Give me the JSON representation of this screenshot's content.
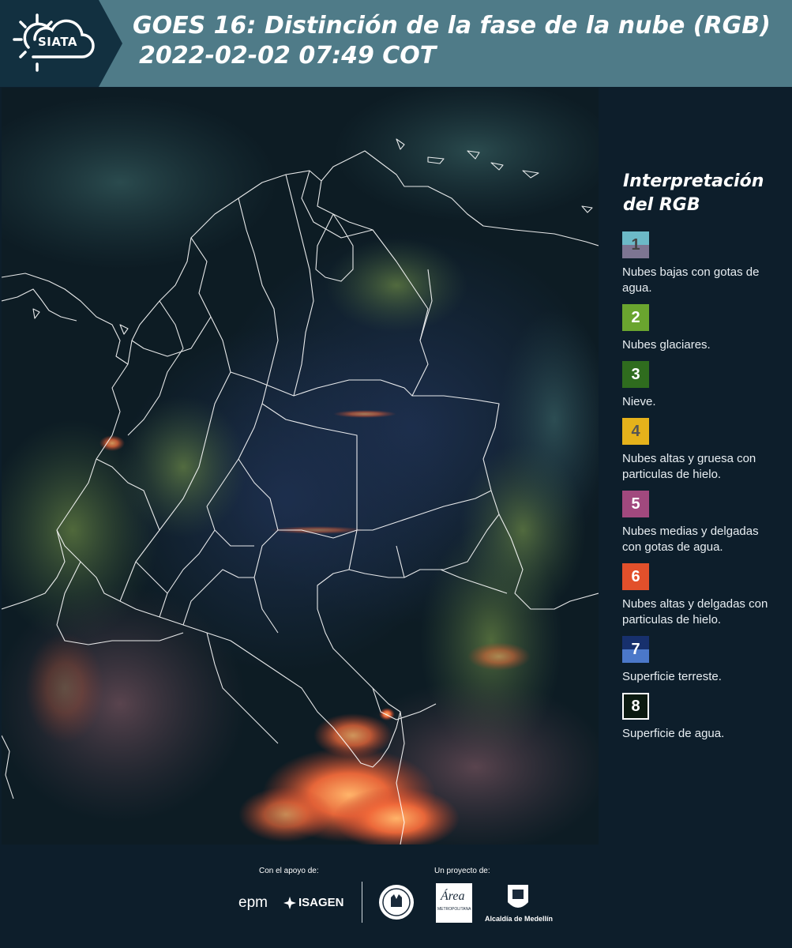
{
  "header": {
    "logo_text": "SIATA",
    "title_line1": "GOES 16: Distinción de la fase de la nube (RGB)",
    "title_line2": "2022-02-02 07:49 COT"
  },
  "legend": {
    "title_line1": "Interpretación",
    "title_line2": "del RGB",
    "items": [
      {
        "number": "1",
        "label": "Nubes bajas con gotas de agua.",
        "color_top": "#6cb9c7",
        "color_bottom": "#7d7592",
        "text_color": "#444444"
      },
      {
        "number": "2",
        "label": "Nubes glaciares.",
        "color": "#6aa52f",
        "text_color": "#ffffff"
      },
      {
        "number": "3",
        "label": "Nieve.",
        "color": "#2f6c1e",
        "text_color": "#ffffff"
      },
      {
        "number": "4",
        "label": "Nubes altas y gruesa con particulas de hielo.",
        "color": "#e5b21b",
        "text_color": "#555555"
      },
      {
        "number": "5",
        "label": "Nubes medias y delgadas con gotas de agua.",
        "color": "#a1497e",
        "text_color": "#ffffff"
      },
      {
        "number": "6",
        "label": "Nubes altas y delgadas con particulas de hielo.",
        "color": "#e2502b",
        "text_color": "#ffffff"
      },
      {
        "number": "7",
        "label": "Superficie terreste.",
        "color_top": "#17306d",
        "color_bottom": "#4b78c9",
        "text_color": "#ffffff"
      },
      {
        "number": "8",
        "label": "Superficie de agua.",
        "color": "#0b1a10",
        "text_color": "#ffffff",
        "border": "#ffffff"
      }
    ]
  },
  "footer": {
    "support_label": "Con el apoyo de:",
    "project_label": "Un proyecto de:",
    "sponsors": [
      "epm",
      "ISAGEN"
    ],
    "metro_text": "Área",
    "metro_sub": "METROPOLITANA",
    "alcaldia": "Alcaldía de Medellín"
  }
}
